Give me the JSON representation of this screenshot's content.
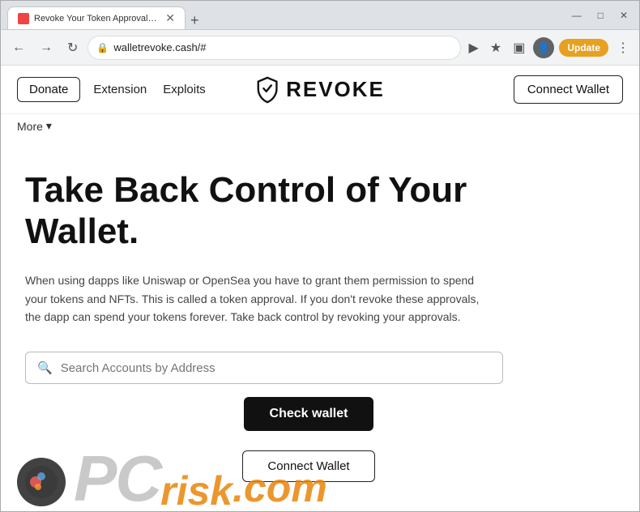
{
  "browser": {
    "tab": {
      "title": "Revoke Your Token Approvals on...",
      "favicon_color": "#cc3333"
    },
    "address_bar": {
      "url": "walletrevoke.cash/#",
      "lock_icon": "🔒"
    },
    "window_controls": {
      "minimize": "—",
      "maximize": "□",
      "close": "✕"
    },
    "update_button": "Update"
  },
  "navbar": {
    "donate_label": "Donate",
    "extension_label": "Extension",
    "exploits_label": "Exploits",
    "brand_name": "REVOKE",
    "connect_wallet_label": "Connect Wallet",
    "more_label": "More",
    "more_icon": "▾"
  },
  "hero": {
    "title_line1": "Take Back Control of Your",
    "title_line2": "Wallet.",
    "description": "When using dapps like Uniswap or OpenSea you have to grant them permission to spend your tokens and NFTs. This is called a token approval. If you don't revoke these approvals, the dapp can spend your tokens forever. Take back control by revoking your approvals.",
    "search_placeholder": "Search Accounts by Address",
    "check_wallet_label": "Check wallet",
    "connect_wallet_label": "Connect Wallet"
  },
  "watermark": {
    "pc_text": "PC",
    "risk_text": "risk",
    "com_text": ".com"
  }
}
